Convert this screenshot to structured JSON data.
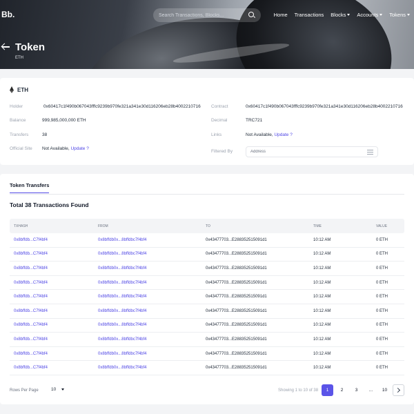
{
  "header": {
    "logo": "Bb.",
    "search_placeholder": "Search Transactions, Blocks...",
    "nav": [
      {
        "label": "Home",
        "dropdown": false
      },
      {
        "label": "Transactions",
        "dropdown": false
      },
      {
        "label": "Blocks",
        "dropdown": true
      },
      {
        "label": "Accounts",
        "dropdown": true
      },
      {
        "label": "Tokens",
        "dropdown": true
      }
    ],
    "page_title": "Token",
    "page_subtitle": "ETH"
  },
  "token": {
    "name": "ETH",
    "holder_label": "Holder",
    "holder": "0x60417c1f490b067043fffc9239b970fe321a341e30d116206eb28b4002210716",
    "balance_label": "Balance",
    "balance": "999,985,000,000 ETH",
    "transfers_label": "Transfers",
    "transfers": "38",
    "official_site_label": "Official Site",
    "official_site": "Not Available,",
    "official_site_update": "Update ?",
    "contract_label": "Contract",
    "contract": "0x60417c1f490b067043fffc9239b970fe321a341e30d116206eb28b4002210716",
    "decimal_label": "Decimal",
    "decimal": "TRC721",
    "links_label": "Links",
    "links": "Not Available,",
    "links_update": "Update ?",
    "filtered_by_label": "Filtered By",
    "filter_placeholder": "Address"
  },
  "transfers": {
    "tab": "Token Transfers",
    "total": "Total 38 Transactions Found",
    "columns": [
      "TXHASH",
      "FROM",
      "TO",
      "TIME",
      "VALUE"
    ],
    "rows": [
      {
        "hash": "0x8bffdb...C7f4bf4",
        "from": "0x8bffdb0x...8bffdbc7f4bf4",
        "to": "0x43477703...E288352515091d1",
        "time": "10:12 AM",
        "value": "0 ETH"
      },
      {
        "hash": "0x8bffdb...C7f4bf4",
        "from": "0x8bffdb0x...8bffdbc7f4bf4",
        "to": "0x43477703...E288352515091d1",
        "time": "10:12 AM",
        "value": "0 ETH"
      },
      {
        "hash": "0x8bffdb...C7f4bf4",
        "from": "0x8bffdb0x...8bffdbc7f4bf4",
        "to": "0x43477703...E288352515091d1",
        "time": "10:12 AM",
        "value": "0 ETH"
      },
      {
        "hash": "0x8bffdb...C7f4bf4",
        "from": "0x8bffdb0x...8bffdbc7f4bf4",
        "to": "0x43477703...E288352515091d1",
        "time": "10:12 AM",
        "value": "0 ETH"
      },
      {
        "hash": "0x8bffdb...C7f4bf4",
        "from": "0x8bffdb0x...8bffdbc7f4bf4",
        "to": "0x43477703...E288352515091d1",
        "time": "10:12 AM",
        "value": "0 ETH"
      },
      {
        "hash": "0x8bffdb...C7f4bf4",
        "from": "0x8bffdb0x...8bffdbc7f4bf4",
        "to": "0x43477703...E288352515091d1",
        "time": "10:12 AM",
        "value": "0 ETH"
      },
      {
        "hash": "0x8bffdb...C7f4bf4",
        "from": "0x8bffdb0x...8bffdbc7f4bf4",
        "to": "0x43477703...E288352515091d1",
        "time": "10:12 AM",
        "value": "0 ETH"
      },
      {
        "hash": "0x8bffdb...C7f4bf4",
        "from": "0x8bffdb0x...8bffdbc7f4bf4",
        "to": "0x43477703...E288352515091d1",
        "time": "10:12 AM",
        "value": "0 ETH"
      },
      {
        "hash": "0x8bffdb...C7f4bf4",
        "from": "0x8bffdb0x...8bffdbc7f4bf4",
        "to": "0x43477703...E288352515091d1",
        "time": "10:12 AM",
        "value": "0 ETH"
      },
      {
        "hash": "0x8bffdb...C7f4bf4",
        "from": "0x8bffdb0x...8bffdbc7f4bf4",
        "to": "0x43477703...E288352515091d1",
        "time": "10:12 AM",
        "value": "0 ETH"
      }
    ]
  },
  "pagination": {
    "rows_per_page_label": "Rows Per Page",
    "rows_per_page": "10",
    "showing": "Showing 1 to 10 of 38",
    "pages": [
      "1",
      "2",
      "3",
      "...",
      "10"
    ],
    "active_page": "1"
  },
  "colors": {
    "accent": "#5b54e8",
    "link": "#4f46e5"
  }
}
